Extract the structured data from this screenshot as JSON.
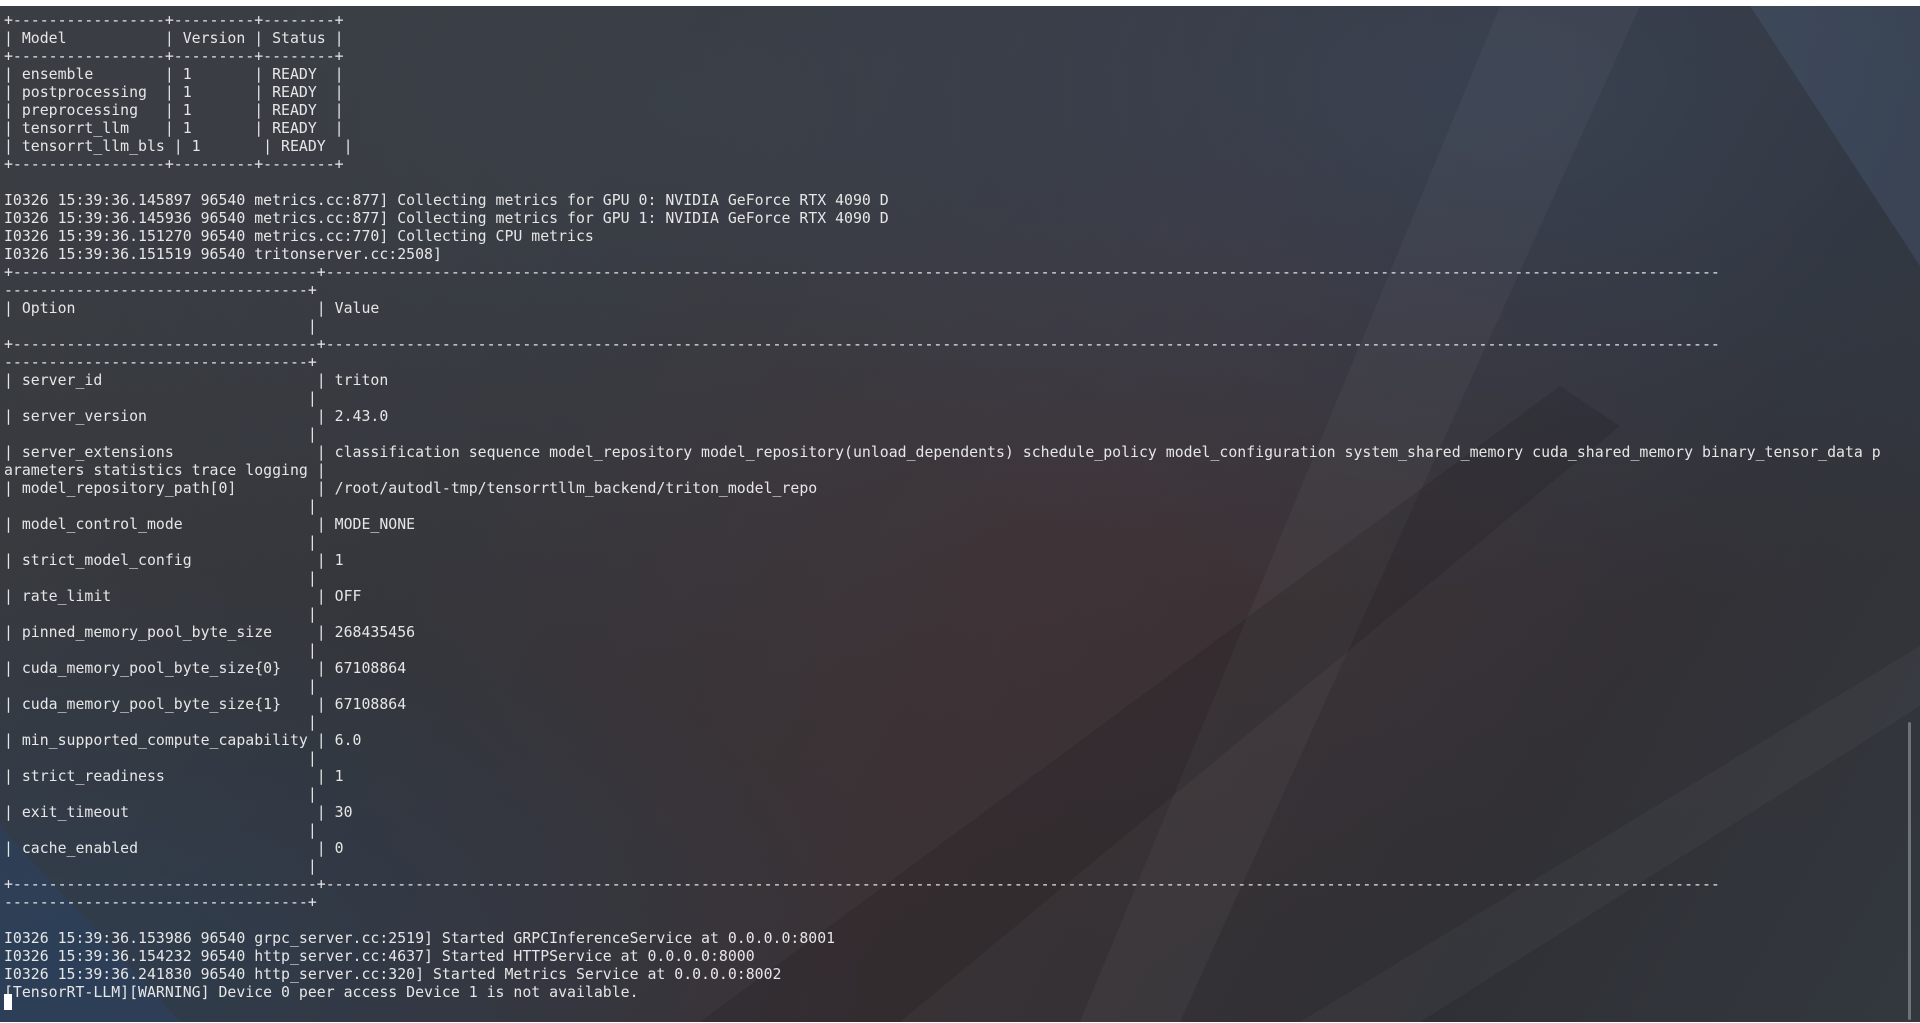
{
  "terminal": {
    "lines": [
      "+-----------------+---------+--------+",
      "| Model           | Version | Status |",
      "+-----------------+---------+--------+",
      "| ensemble        | 1       | READY  |",
      "| postprocessing  | 1       | READY  |",
      "| preprocessing   | 1       | READY  |",
      "| tensorrt_llm    | 1       | READY  |",
      "| tensorrt_llm_bls | 1       | READY  |",
      "+-----------------+---------+--------+",
      "",
      "I0326 15:39:36.145897 96540 metrics.cc:877] Collecting metrics for GPU 0: NVIDIA GeForce RTX 4090 D",
      "I0326 15:39:36.145936 96540 metrics.cc:877] Collecting metrics for GPU 1: NVIDIA GeForce RTX 4090 D",
      "I0326 15:39:36.151270 96540 metrics.cc:770] Collecting CPU metrics",
      "I0326 15:39:36.151519 96540 tritonserver.cc:2508]",
      "+----------------------------------+------------------------------------------------------------------------------------------------------------------------------------------------------------",
      "----------------------------------+",
      "| Option                           | Value",
      "                                  |",
      "+----------------------------------+------------------------------------------------------------------------------------------------------------------------------------------------------------",
      "----------------------------------+",
      "| server_id                        | triton",
      "                                  |",
      "| server_version                   | 2.43.0",
      "                                  |",
      "| server_extensions                | classification sequence model_repository model_repository(unload_dependents) schedule_policy model_configuration system_shared_memory cuda_shared_memory binary_tensor_data p",
      "arameters statistics trace logging |",
      "| model_repository_path[0]         | /root/autodl-tmp/tensorrtllm_backend/triton_model_repo",
      "                                  |",
      "| model_control_mode               | MODE_NONE",
      "                                  |",
      "| strict_model_config              | 1",
      "                                  |",
      "| rate_limit                       | OFF",
      "                                  |",
      "| pinned_memory_pool_byte_size     | 268435456",
      "                                  |",
      "| cuda_memory_pool_byte_size{0}    | 67108864",
      "                                  |",
      "| cuda_memory_pool_byte_size{1}    | 67108864",
      "                                  |",
      "| min_supported_compute_capability | 6.0",
      "                                  |",
      "| strict_readiness                 | 1",
      "                                  |",
      "| exit_timeout                     | 30",
      "                                  |",
      "| cache_enabled                    | 0",
      "                                  |",
      "+----------------------------------+------------------------------------------------------------------------------------------------------------------------------------------------------------",
      "----------------------------------+",
      "",
      "I0326 15:39:36.153986 96540 grpc_server.cc:2519] Started GRPCInferenceService at 0.0.0.0:8001",
      "I0326 15:39:36.154232 96540 http_server.cc:4637] Started HTTPService at 0.0.0.0:8000",
      "I0326 15:39:36.241830 96540 http_server.cc:320] Started Metrics Service at 0.0.0.0:8002",
      "[TensorRT-LLM][WARNING] Device 0 peer access Device 1 is not available."
    ]
  },
  "colors": {
    "terminal_text": "#e6e6e6",
    "cursor": "#ffffff",
    "desktop_background": "#35363b"
  },
  "icons": {
    "cursor": "block-cursor-icon",
    "scrollbar": "scrollbar-thumb"
  }
}
